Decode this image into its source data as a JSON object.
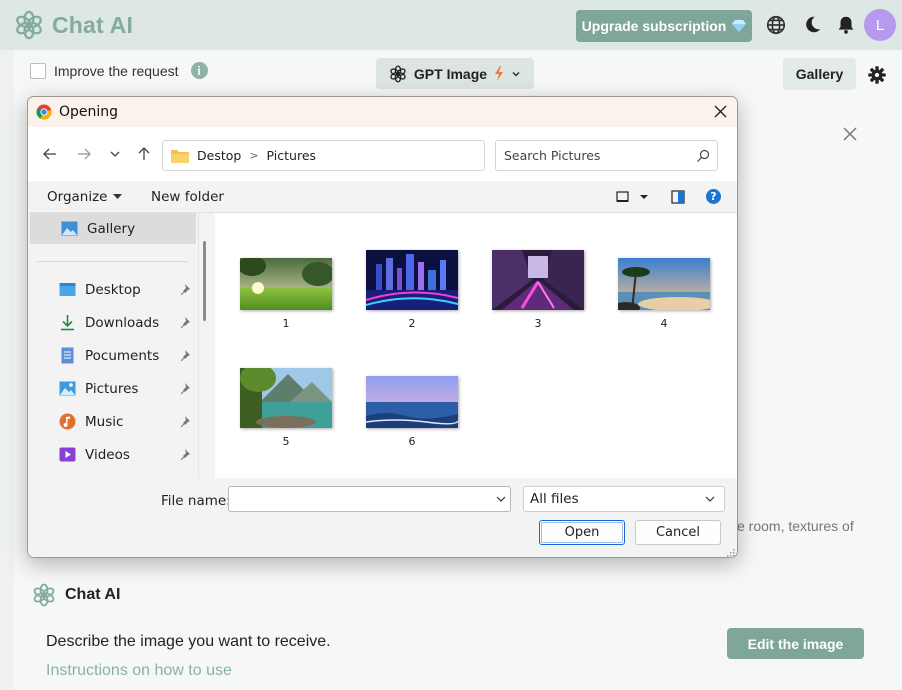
{
  "app": {
    "brand_name": "Chat AI",
    "upgrade_label": "Upgrade subscription",
    "avatar_letter": "L",
    "accent_color": "#7ea799"
  },
  "toolbar": {
    "improve_label": "Improve the request",
    "model_label": "GPT Image",
    "gallery_label": "Gallery"
  },
  "background": {
    "partial_text": "e room, textures of"
  },
  "chat": {
    "title": "Chat AI",
    "describe_text": "Describe the image you want to receive.",
    "instructions_link": "Instructions on how to use",
    "edit_button": "Edit the image"
  },
  "dialog": {
    "title": "Opening",
    "address": {
      "segments": [
        "Destop",
        "Pictures"
      ]
    },
    "search_placeholder": "Search Pictures",
    "organize_label": "Organize",
    "new_folder_label": "New folder",
    "sidebar": {
      "items": [
        {
          "label": "Gallery",
          "icon": "gallery-icon",
          "selected": true
        },
        {
          "label": "Desktop",
          "icon": "desktop-icon",
          "pinned": true
        },
        {
          "label": "Downloads",
          "icon": "download-icon",
          "pinned": true
        },
        {
          "label": "Pocuments",
          "icon": "document-icon",
          "pinned": true
        },
        {
          "label": "Pictures",
          "icon": "pictures-icon",
          "pinned": true
        },
        {
          "label": "Music",
          "icon": "music-icon",
          "pinned": true
        },
        {
          "label": "Videos",
          "icon": "videos-icon",
          "pinned": true
        }
      ]
    },
    "files": [
      {
        "label": "1"
      },
      {
        "label": "2"
      },
      {
        "label": "3"
      },
      {
        "label": "4"
      },
      {
        "label": "5"
      },
      {
        "label": "6"
      }
    ],
    "file_name_label": "File name:",
    "file_name_value": "",
    "filter_label": "All files",
    "open_label": "Open",
    "cancel_label": "Cancel"
  }
}
